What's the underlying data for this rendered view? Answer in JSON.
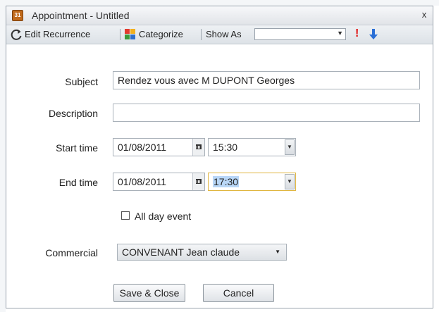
{
  "window": {
    "title": "Appointment - Untitled",
    "close_glyph": "x"
  },
  "toolbar": {
    "edit_recurrence": "Edit Recurrence",
    "categorize": "Categorize",
    "show_as": "Show As",
    "show_as_value": "",
    "icons": [
      "refresh-icon",
      "categorize-icon",
      "high-importance-icon",
      "low-importance-icon"
    ]
  },
  "form": {
    "subject_label": "Subject",
    "subject_value": "Rendez vous avec M DUPONT Georges",
    "description_label": "Description",
    "description_value": "",
    "start_label": "Start time",
    "start_date": "01/08/2011",
    "start_time": "15:30",
    "end_label": "End time",
    "end_date": "01/08/2011",
    "end_time": "17:30",
    "all_day_label": "All day event",
    "all_day_checked": false,
    "commercial_label": "Commercial",
    "commercial_value": "CONVENANT Jean claude"
  },
  "buttons": {
    "save": "Save & Close",
    "cancel": "Cancel"
  },
  "colors": {
    "focus_border": "#e0b640",
    "selection": "#b9d7f7",
    "importance_high": "#e01010",
    "importance_low": "#2a6fd6"
  }
}
